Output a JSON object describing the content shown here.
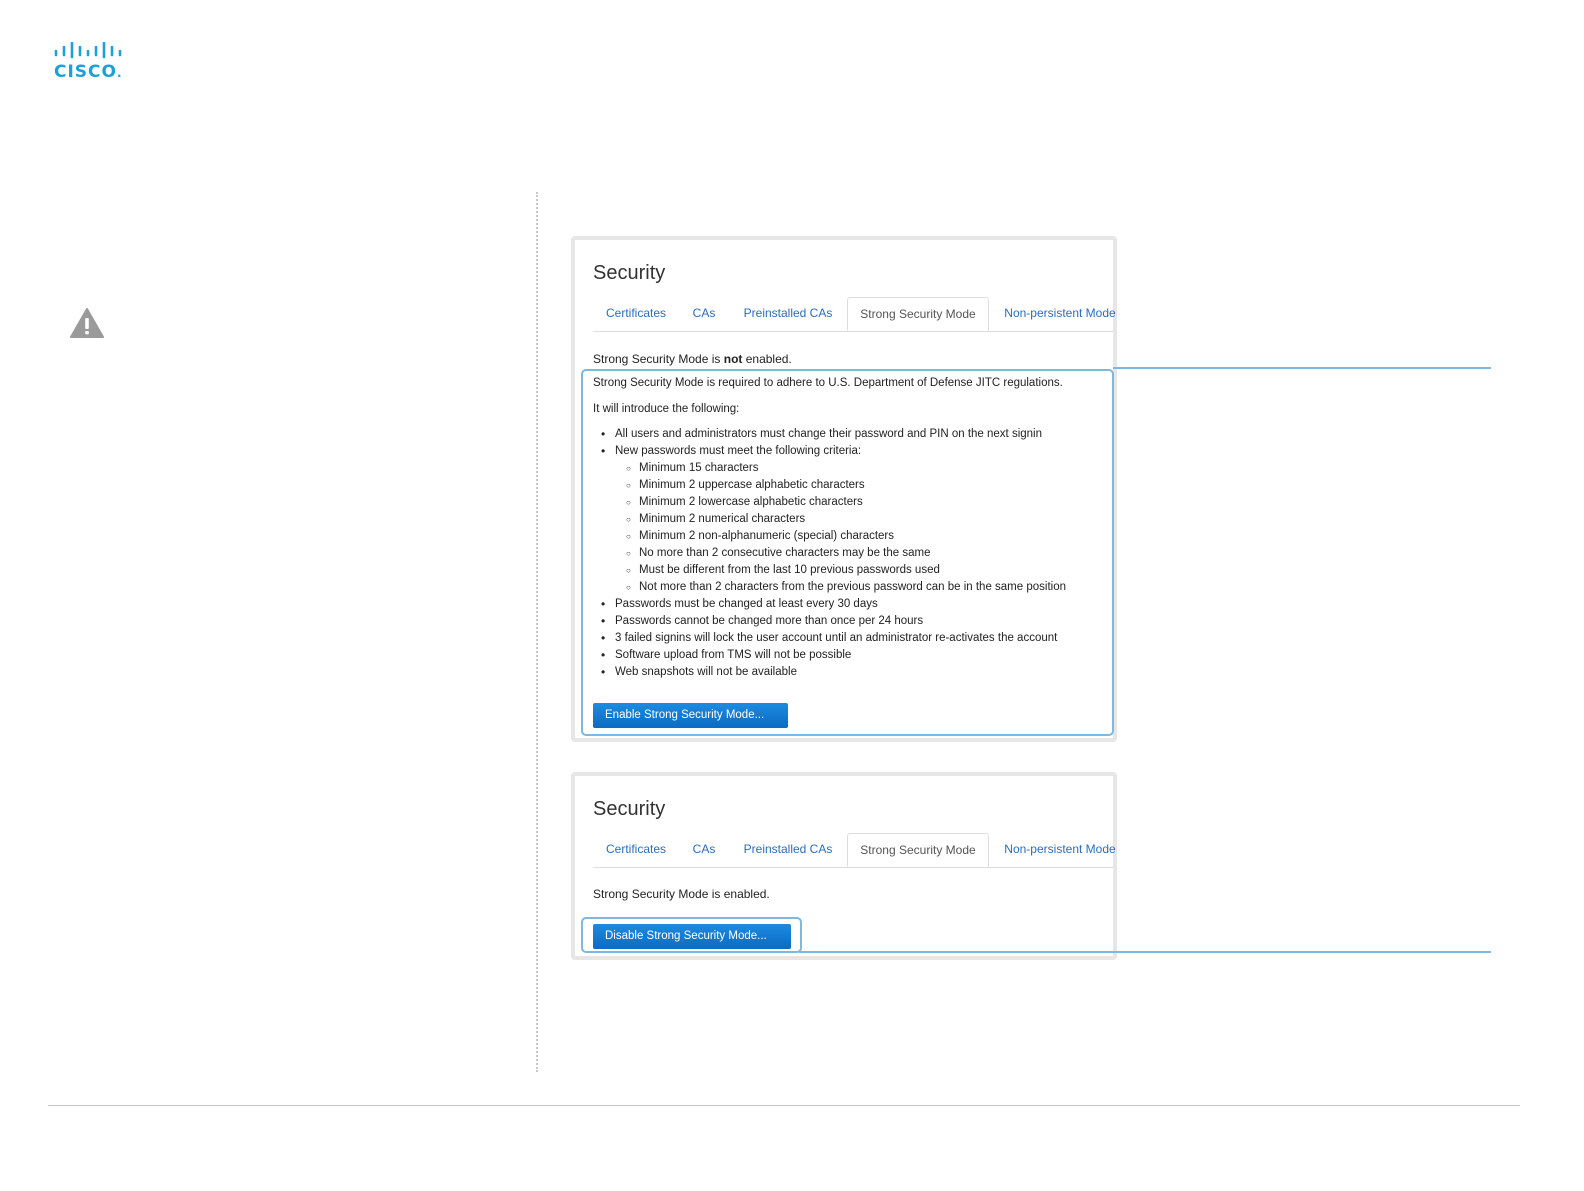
{
  "logo": {
    "text": "CISCO",
    "icon": "cisco-bridge-logo"
  },
  "warning": {
    "icon": "warning-triangle-icon"
  },
  "panel1": {
    "title": "Security",
    "tabs": [
      "Certificates",
      "CAs",
      "Preinstalled CAs",
      "Strong Security Mode",
      "Non-persistent Mode"
    ],
    "active_tab": "Strong Security Mode",
    "status_prefix": "Strong Security Mode is ",
    "status_bold": "not",
    "status_suffix": " enabled.",
    "intro": "Strong Security Mode is required to adhere to U.S. Department of Defense JITC regulations.",
    "lead": "It will introduce the following:",
    "items": [
      {
        "level": 1,
        "text": "All users and administrators must change their password and PIN on the next signin"
      },
      {
        "level": 1,
        "text": "New passwords must meet the following criteria:"
      },
      {
        "level": 2,
        "text": "Minimum 15 characters"
      },
      {
        "level": 2,
        "text": "Minimum 2 uppercase alphabetic characters"
      },
      {
        "level": 2,
        "text": "Minimum 2 lowercase alphabetic characters"
      },
      {
        "level": 2,
        "text": "Minimum 2 numerical characters"
      },
      {
        "level": 2,
        "text": "Minimum 2 non-alphanumeric (special) characters"
      },
      {
        "level": 2,
        "text": "No more than 2 consecutive characters may be the same"
      },
      {
        "level": 2,
        "text": "Must be different from the last 10 previous passwords used"
      },
      {
        "level": 2,
        "text": "Not more than 2 characters from the previous password can be in the same position"
      },
      {
        "level": 1,
        "text": "Passwords must be changed at least every 30 days"
      },
      {
        "level": 1,
        "text": "Passwords cannot be changed more than once per 24 hours"
      },
      {
        "level": 1,
        "text": "3 failed signins will lock the user account until an administrator re-activates the account"
      },
      {
        "level": 1,
        "text": "Software upload from TMS will not be possible"
      },
      {
        "level": 1,
        "text": "Web snapshots will not be available"
      }
    ],
    "button": "Enable Strong Security Mode..."
  },
  "panel2": {
    "title": "Security",
    "tabs": [
      "Certificates",
      "CAs",
      "Preinstalled CAs",
      "Strong Security Mode",
      "Non-persistent Mode"
    ],
    "active_tab": "Strong Security Mode",
    "status": "Strong Security Mode is enabled.",
    "button": "Disable Strong Security Mode..."
  },
  "colors": {
    "accent": "#0a6bc2",
    "link": "#2a6ebb",
    "callout": "#7fb7dd",
    "logo": "#1ba0d7"
  }
}
